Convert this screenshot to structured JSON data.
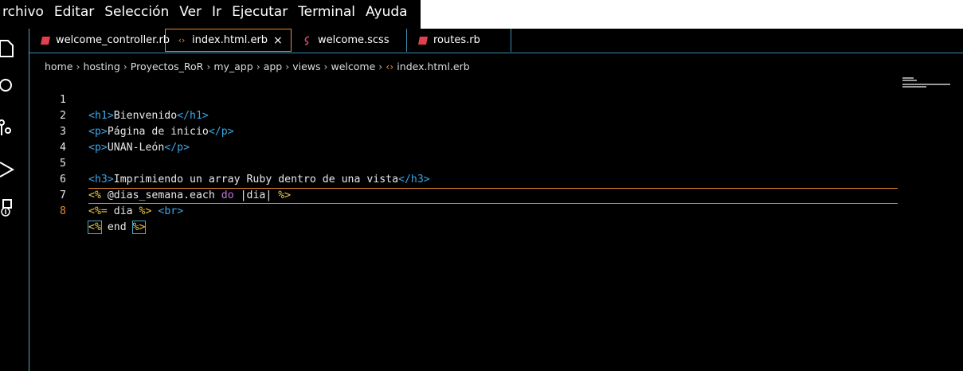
{
  "menubar": {
    "items": [
      "rchivo",
      "Editar",
      "Selección",
      "Ver",
      "Ir",
      "Ejecutar",
      "Terminal",
      "Ayuda"
    ]
  },
  "tabs": [
    {
      "label": "welcome_controller.rb",
      "icon": "ruby-icon",
      "color": "#e2404f"
    },
    {
      "label": "index.html.erb",
      "icon": "code-icon",
      "color": "#e78a2e",
      "close": "×"
    },
    {
      "label": "welcome.scss",
      "icon": "sass-icon",
      "color": "#d1477a"
    },
    {
      "label": "routes.rb",
      "icon": "ruby-icon",
      "color": "#e2404f"
    }
  ],
  "breadcrumb": [
    "home",
    "hosting",
    "Proyectos_RoR",
    "my_app",
    "app",
    "views",
    "welcome",
    "index.html.erb"
  ],
  "editor": {
    "line_numbers": [
      "1",
      "2",
      "3",
      "4",
      "5",
      "6",
      "7",
      "8"
    ],
    "lines": [
      {
        "open": "<h1>",
        "text": "Bienvenido",
        "close": "</h1>"
      },
      {
        "open": "<p>",
        "text": "Página de inicio",
        "close": "</p>"
      },
      {
        "open": "<p>",
        "text": "UNAN-León",
        "close": "</p>"
      },
      {
        "open": "",
        "text": "",
        "close": ""
      },
      {
        "open": "<h3>",
        "text": "Imprimiendo un array Ruby dentro de una vista",
        "close": "</h3>"
      },
      {
        "erb_open": "<%",
        "pre": " @dias_semana.each ",
        "kw": "do",
        "post": " |dia| ",
        "erb_close": "%>"
      },
      {
        "erb_open": "<%=",
        "pre": " dia ",
        "erb_close": "%>",
        "tag": "<br>"
      },
      {
        "erb_open": "<%",
        "pre": " end ",
        "erb_close": "%>"
      }
    ]
  },
  "colors": {
    "accent": "#e78a2e",
    "border": "#3a8fb0",
    "tag": "#3ca6e6",
    "erb": "#f0c63a"
  }
}
